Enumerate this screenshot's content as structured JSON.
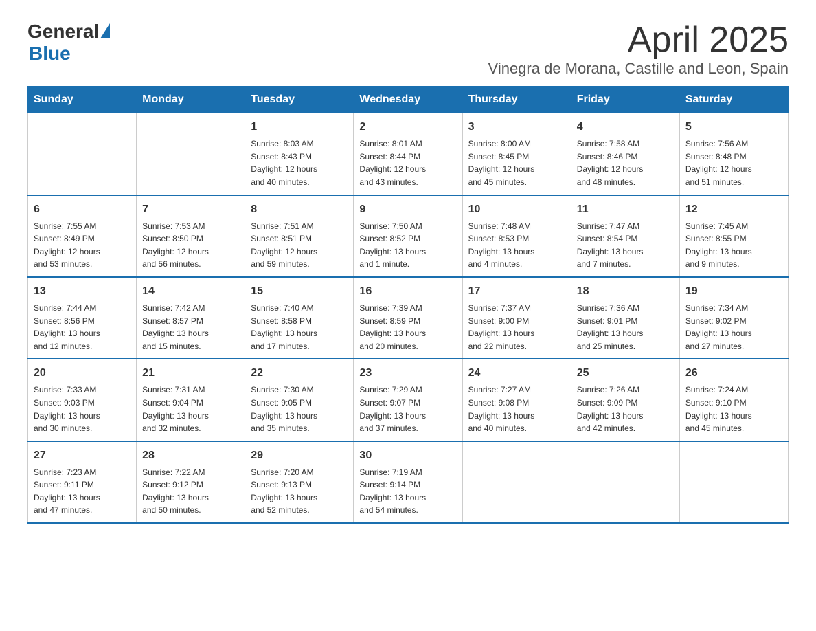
{
  "header": {
    "logo_general": "General",
    "logo_blue": "Blue",
    "month_title": "April 2025",
    "location": "Vinegra de Morana, Castille and Leon, Spain"
  },
  "weekdays": [
    "Sunday",
    "Monday",
    "Tuesday",
    "Wednesday",
    "Thursday",
    "Friday",
    "Saturday"
  ],
  "weeks": [
    [
      {
        "day": "",
        "info": ""
      },
      {
        "day": "",
        "info": ""
      },
      {
        "day": "1",
        "info": "Sunrise: 8:03 AM\nSunset: 8:43 PM\nDaylight: 12 hours\nand 40 minutes."
      },
      {
        "day": "2",
        "info": "Sunrise: 8:01 AM\nSunset: 8:44 PM\nDaylight: 12 hours\nand 43 minutes."
      },
      {
        "day": "3",
        "info": "Sunrise: 8:00 AM\nSunset: 8:45 PM\nDaylight: 12 hours\nand 45 minutes."
      },
      {
        "day": "4",
        "info": "Sunrise: 7:58 AM\nSunset: 8:46 PM\nDaylight: 12 hours\nand 48 minutes."
      },
      {
        "day": "5",
        "info": "Sunrise: 7:56 AM\nSunset: 8:48 PM\nDaylight: 12 hours\nand 51 minutes."
      }
    ],
    [
      {
        "day": "6",
        "info": "Sunrise: 7:55 AM\nSunset: 8:49 PM\nDaylight: 12 hours\nand 53 minutes."
      },
      {
        "day": "7",
        "info": "Sunrise: 7:53 AM\nSunset: 8:50 PM\nDaylight: 12 hours\nand 56 minutes."
      },
      {
        "day": "8",
        "info": "Sunrise: 7:51 AM\nSunset: 8:51 PM\nDaylight: 12 hours\nand 59 minutes."
      },
      {
        "day": "9",
        "info": "Sunrise: 7:50 AM\nSunset: 8:52 PM\nDaylight: 13 hours\nand 1 minute."
      },
      {
        "day": "10",
        "info": "Sunrise: 7:48 AM\nSunset: 8:53 PM\nDaylight: 13 hours\nand 4 minutes."
      },
      {
        "day": "11",
        "info": "Sunrise: 7:47 AM\nSunset: 8:54 PM\nDaylight: 13 hours\nand 7 minutes."
      },
      {
        "day": "12",
        "info": "Sunrise: 7:45 AM\nSunset: 8:55 PM\nDaylight: 13 hours\nand 9 minutes."
      }
    ],
    [
      {
        "day": "13",
        "info": "Sunrise: 7:44 AM\nSunset: 8:56 PM\nDaylight: 13 hours\nand 12 minutes."
      },
      {
        "day": "14",
        "info": "Sunrise: 7:42 AM\nSunset: 8:57 PM\nDaylight: 13 hours\nand 15 minutes."
      },
      {
        "day": "15",
        "info": "Sunrise: 7:40 AM\nSunset: 8:58 PM\nDaylight: 13 hours\nand 17 minutes."
      },
      {
        "day": "16",
        "info": "Sunrise: 7:39 AM\nSunset: 8:59 PM\nDaylight: 13 hours\nand 20 minutes."
      },
      {
        "day": "17",
        "info": "Sunrise: 7:37 AM\nSunset: 9:00 PM\nDaylight: 13 hours\nand 22 minutes."
      },
      {
        "day": "18",
        "info": "Sunrise: 7:36 AM\nSunset: 9:01 PM\nDaylight: 13 hours\nand 25 minutes."
      },
      {
        "day": "19",
        "info": "Sunrise: 7:34 AM\nSunset: 9:02 PM\nDaylight: 13 hours\nand 27 minutes."
      }
    ],
    [
      {
        "day": "20",
        "info": "Sunrise: 7:33 AM\nSunset: 9:03 PM\nDaylight: 13 hours\nand 30 minutes."
      },
      {
        "day": "21",
        "info": "Sunrise: 7:31 AM\nSunset: 9:04 PM\nDaylight: 13 hours\nand 32 minutes."
      },
      {
        "day": "22",
        "info": "Sunrise: 7:30 AM\nSunset: 9:05 PM\nDaylight: 13 hours\nand 35 minutes."
      },
      {
        "day": "23",
        "info": "Sunrise: 7:29 AM\nSunset: 9:07 PM\nDaylight: 13 hours\nand 37 minutes."
      },
      {
        "day": "24",
        "info": "Sunrise: 7:27 AM\nSunset: 9:08 PM\nDaylight: 13 hours\nand 40 minutes."
      },
      {
        "day": "25",
        "info": "Sunrise: 7:26 AM\nSunset: 9:09 PM\nDaylight: 13 hours\nand 42 minutes."
      },
      {
        "day": "26",
        "info": "Sunrise: 7:24 AM\nSunset: 9:10 PM\nDaylight: 13 hours\nand 45 minutes."
      }
    ],
    [
      {
        "day": "27",
        "info": "Sunrise: 7:23 AM\nSunset: 9:11 PM\nDaylight: 13 hours\nand 47 minutes."
      },
      {
        "day": "28",
        "info": "Sunrise: 7:22 AM\nSunset: 9:12 PM\nDaylight: 13 hours\nand 50 minutes."
      },
      {
        "day": "29",
        "info": "Sunrise: 7:20 AM\nSunset: 9:13 PM\nDaylight: 13 hours\nand 52 minutes."
      },
      {
        "day": "30",
        "info": "Sunrise: 7:19 AM\nSunset: 9:14 PM\nDaylight: 13 hours\nand 54 minutes."
      },
      {
        "day": "",
        "info": ""
      },
      {
        "day": "",
        "info": ""
      },
      {
        "day": "",
        "info": ""
      }
    ]
  ]
}
